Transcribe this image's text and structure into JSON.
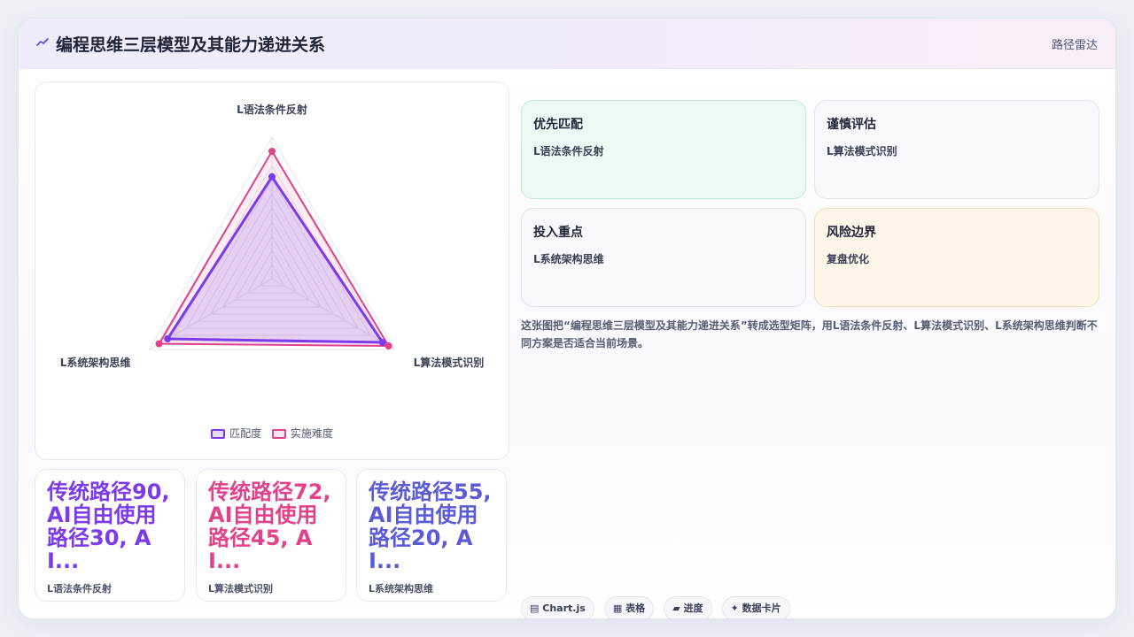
{
  "header": {
    "icon": "line-chart-icon",
    "title": "编程思维三层模型及其能力递进关系",
    "right_label": "路径雷达"
  },
  "colors": {
    "match": "#7c3aed",
    "difficulty": "#e0438b",
    "stat_1": "#7c3aed",
    "stat_2": "#e0438b",
    "stat_3": "#5b5bd6"
  },
  "chart_data": {
    "type": "radar",
    "axes": [
      "L语法条件反射",
      "L算法模式识别",
      "L系统架构思维"
    ],
    "range": [
      0,
      100
    ],
    "grid": true,
    "legend_position": "bottom",
    "series": [
      {
        "name": "匹配度",
        "values": [
          72,
          90,
          85
        ]
      },
      {
        "name": "实施难度",
        "values": [
          90,
          95,
          92
        ]
      }
    ]
  },
  "stats": [
    {
      "value": "传统路径90, AI自由使用路径30, AI...",
      "label": "L语法条件反射"
    },
    {
      "value": "传统路径72, AI自由使用路径45, AI...",
      "label": "L算法模式识别"
    },
    {
      "value": "传统路径55, AI自由使用路径20, AI...",
      "label": "L系统架构思维"
    }
  ],
  "matrix": [
    {
      "title": "优先匹配",
      "value": "L语法条件反射"
    },
    {
      "title": "谨慎评估",
      "value": "L算法模式识别"
    },
    {
      "title": "投入重点",
      "value": "L系统架构思维"
    },
    {
      "title": "风险边界",
      "value": "复盘优化"
    }
  ],
  "description": "这张图把“编程思维三层模型及其能力递进关系”转成选型矩阵，用L语法条件反射、L算法模式识别、L系统架构思维判断不同方案是否适合当前场景。",
  "tags": [
    {
      "icon": "chart-icon",
      "glyph": "▤",
      "label": "Chart.js"
    },
    {
      "icon": "table-icon",
      "glyph": "▦",
      "label": "表格"
    },
    {
      "icon": "progress-icon",
      "glyph": "▰",
      "label": "进度"
    },
    {
      "icon": "data-card-icon",
      "glyph": "✦",
      "label": "数据卡片"
    }
  ]
}
